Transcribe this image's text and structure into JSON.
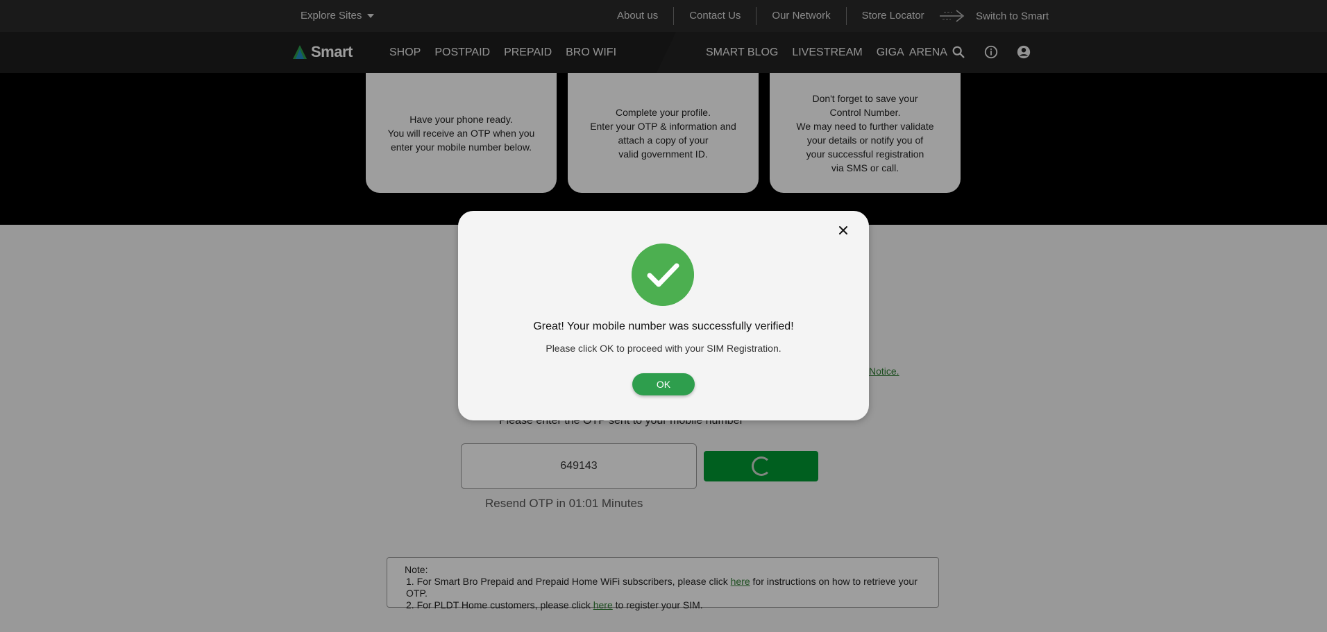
{
  "topbar": {
    "explore_label": "Explore Sites",
    "links": [
      "About us",
      "Contact Us",
      "Our Network",
      "Store Locator"
    ],
    "switch_label": "Switch to Smart"
  },
  "nav": {
    "logo_text": "Smart",
    "left_items": [
      "SHOP",
      "POSTPAID",
      "PREPAID",
      "BRO WIFI"
    ],
    "right_items": [
      "SMART BLOG",
      "LIVESTREAM",
      "GIGA  ARENA"
    ],
    "icons": [
      "search-icon",
      "info-icon",
      "account-icon"
    ]
  },
  "steps": [
    {
      "text": "Have your phone ready.\nYou will receive an OTP when you\nenter your mobile number below."
    },
    {
      "text": "Complete your profile.\nEnter your OTP & information and\nattach a copy of your\nvalid government ID."
    },
    {
      "text": "Don't forget to save your\nControl Number.\nWe may need to further validate\nyour details or notify you of\nyour successful registration\nvia SMS or call."
    }
  ],
  "form": {
    "partial_link": "Notice.",
    "otp_label": "Please enter the OTP sent to your mobile number",
    "otp_value": "649143",
    "resend_text": "Resend OTP in 01:01 Minutes"
  },
  "note": {
    "heading": "Note:",
    "line1_pre": "1. For Smart Bro Prepaid and Prepaid Home WiFi subscribers, please click ",
    "line1_link": "here",
    "line1_post": " for instructions on how to retrieve your OTP.",
    "line2_pre": "2. For PLDT Home customers, please click ",
    "line2_link": "here",
    "line2_post": " to register your SIM."
  },
  "modal": {
    "title": "Great! Your mobile number was successfully verified!",
    "subtitle": "Please click OK to proceed with your SIM Registration.",
    "ok_label": "OK"
  },
  "colors": {
    "brand_green": "#009933",
    "success_green": "#4caf50",
    "link_green": "#2e7d32"
  }
}
